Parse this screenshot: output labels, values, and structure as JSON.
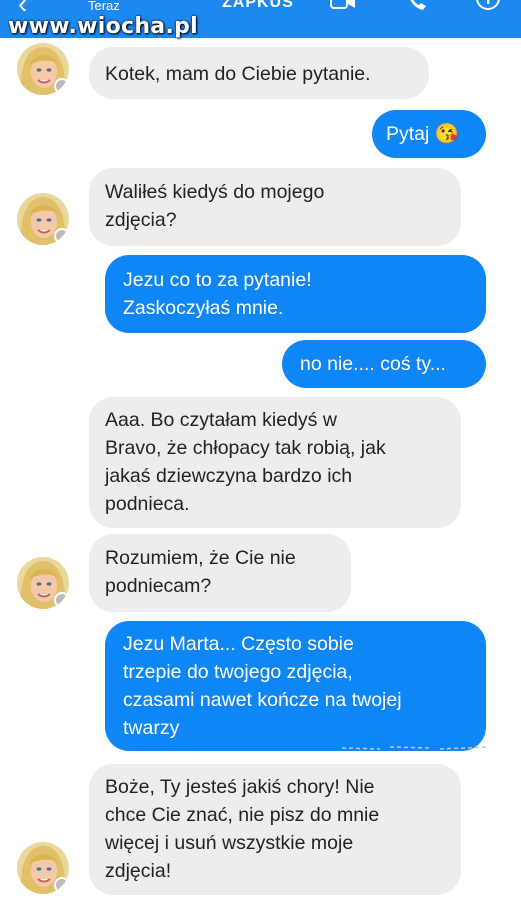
{
  "watermark": "www.wiocha.pl",
  "header": {
    "status": "Teraz",
    "title": "ZAPKUS",
    "back_icon": "arrow-left-icon",
    "video_icon": "video-camera-icon",
    "call_icon": "phone-icon",
    "info_icon": "info-icon"
  },
  "colors": {
    "header": "#1d88f0",
    "outgoing": "#0e86f5",
    "incoming": "#ededed"
  },
  "messages": [
    {
      "side": "in",
      "text": "Kotek, mam do Ciebie pytanie."
    },
    {
      "side": "out",
      "text": "Pytaj 😘"
    },
    {
      "side": "in",
      "text": "Waliłeś kiedyś do mojego\nzdjęcia?"
    },
    {
      "side": "out",
      "text": "Jezu co to za pytanie!\nZaskoczyłaś mnie."
    },
    {
      "side": "out",
      "text": "no nie.... coś ty..."
    },
    {
      "side": "in",
      "text": "Aaa. Bo czytałam kiedyś w\nBravo, że chłopacy tak robią, jak\njakaś dziewczyna bardzo ich\npodnieca."
    },
    {
      "side": "in",
      "text": "Rozumiem, że Cie nie\npodniecam?"
    },
    {
      "side": "out",
      "text": "Jezu Marta... Często sobie\ntrzepie do twojego zdjęcia,\nczasami nawet kończe na twojej\ntwarzy"
    },
    {
      "side": "in",
      "text": "Boże, Ty jesteś jakiś chory! Nie\nchce Cie znać, nie pisz do mnie\nwięcej i usuń wszystkie moje\nzdjęcia!"
    }
  ]
}
